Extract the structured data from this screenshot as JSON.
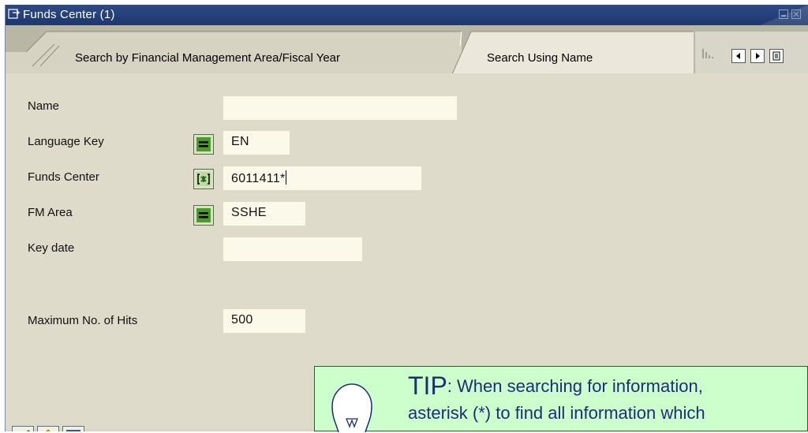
{
  "window": {
    "title": "Funds Center (1)"
  },
  "tabs": [
    {
      "label": "Search by Financial Management Area/Fiscal Year",
      "active": false
    },
    {
      "label": "Search Using Name",
      "active": true
    }
  ],
  "fields": {
    "name": {
      "label": "Name",
      "value": ""
    },
    "language_key": {
      "label": "Language Key",
      "value": "EN",
      "operator": "equals"
    },
    "funds_center": {
      "label": "Funds Center",
      "value": "6011411*",
      "operator": "pattern"
    },
    "fm_area": {
      "label": "FM Area",
      "value": "SSHE",
      "operator": "equals"
    },
    "key_date": {
      "label": "Key date",
      "value": ""
    },
    "max_hits": {
      "label": "Maximum No. of Hits",
      "value": "500"
    }
  },
  "toolbar": {
    "buttons": [
      {
        "icon": "checkmark-icon"
      },
      {
        "icon": "multiple-selection-icon"
      },
      {
        "icon": "cancel-icon"
      }
    ]
  },
  "tip": {
    "heading": "TIP",
    "line1": ":  When searching for information,",
    "line2": "asterisk (*) to find all information which"
  },
  "colors": {
    "titlebar": "#1d3770",
    "background": "#dedbcb",
    "input": "#fbf9ea",
    "tip_background": "#ccffcc",
    "tip_text": "#1d2d7a"
  }
}
